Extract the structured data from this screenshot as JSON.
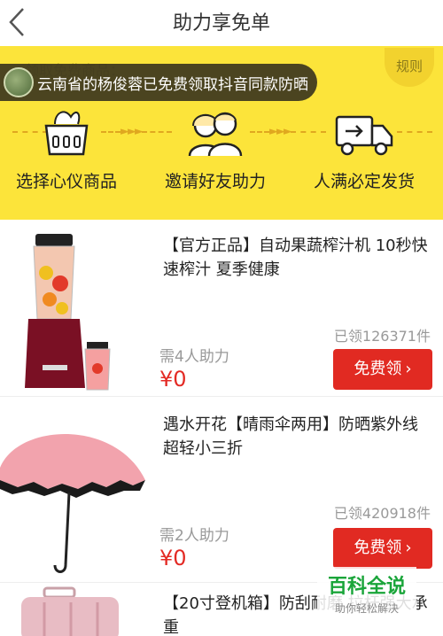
{
  "header": {
    "title": "助力享免单"
  },
  "banner": {
    "faint_text": "领取免费商品：",
    "rule_label": "规则",
    "notice_text": "云南省的杨俊蓉已免费领取抖音同款防晒",
    "steps": [
      {
        "label": "选择心仪商品",
        "icon": "basket-icon"
      },
      {
        "label": "邀请好友助力",
        "icon": "friends-icon"
      },
      {
        "label": "人满必定发货",
        "icon": "truck-icon"
      }
    ]
  },
  "products": [
    {
      "title": "【官方正品】自动果蔬榨汁机 10秒快速榨汁 夏季健康",
      "claimed": "已领126371件",
      "need": "需4人助力",
      "price": "¥0",
      "button": "免费领"
    },
    {
      "title": "遇水开花【晴雨伞两用】防晒紫外线 超轻小三折",
      "claimed": "已领420918件",
      "need": "需2人助力",
      "price": "¥0",
      "button": "免费领"
    },
    {
      "title": "【20寸登机箱】防刮耐磨 拉杆强大承重",
      "claimed": "",
      "need": "",
      "price": "",
      "button": ""
    }
  ],
  "watermark": {
    "main": "百科全说",
    "sub": "助你轻松解决"
  },
  "colors": {
    "banner": "#fce43a",
    "accent_red": "#e12a22",
    "price_red": "#e32a24"
  }
}
